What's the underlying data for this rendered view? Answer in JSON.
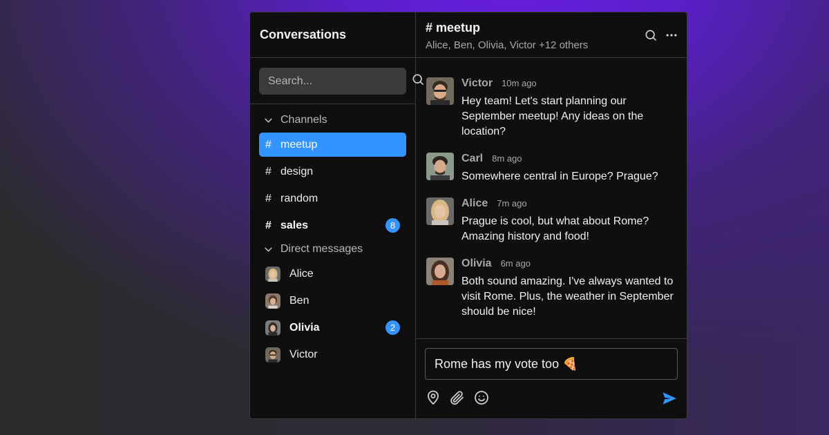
{
  "sidebar": {
    "title": "Conversations",
    "search_placeholder": "Search...",
    "channels_label": "Channels",
    "channels": [
      {
        "name": "meetup",
        "active": true,
        "unread": ""
      },
      {
        "name": "design",
        "active": false,
        "unread": ""
      },
      {
        "name": "random",
        "active": false,
        "unread": ""
      },
      {
        "name": "sales",
        "active": false,
        "unread": "8"
      }
    ],
    "dms_label": "Direct messages",
    "dms": [
      {
        "name": "Alice",
        "unread": ""
      },
      {
        "name": "Ben",
        "unread": ""
      },
      {
        "name": "Olivia",
        "unread": "2"
      },
      {
        "name": "Victor",
        "unread": ""
      }
    ],
    "hash": "#"
  },
  "header": {
    "title": "# meetup",
    "members": "Alice, Ben, Olivia, Victor +12 others"
  },
  "messages": [
    {
      "author": "Victor",
      "time": "10m ago",
      "text": "Hey team! Let's start planning our September meetup! Any ideas on the location?"
    },
    {
      "author": "Carl",
      "time": "8m ago",
      "text": "Somewhere central in Europe? Prague?"
    },
    {
      "author": "Alice",
      "time": "7m ago",
      "text": "Prague is cool, but what about Rome? Amazing history and food!"
    },
    {
      "author": "Olivia",
      "time": "6m ago",
      "text": "Both sound amazing. I've always wanted to visit Rome. Plus, the weather in September should be nice!"
    }
  ],
  "composer": {
    "value": "Rome has my vote too 🍕"
  },
  "colors": {
    "accent": "#3393ff",
    "panel": "#0f0f10",
    "border": "#3a3a3e"
  },
  "icons": [
    "search-icon",
    "chevron-down-icon",
    "more-icon",
    "location-pin-icon",
    "paperclip-icon",
    "smiley-icon",
    "send-icon"
  ]
}
